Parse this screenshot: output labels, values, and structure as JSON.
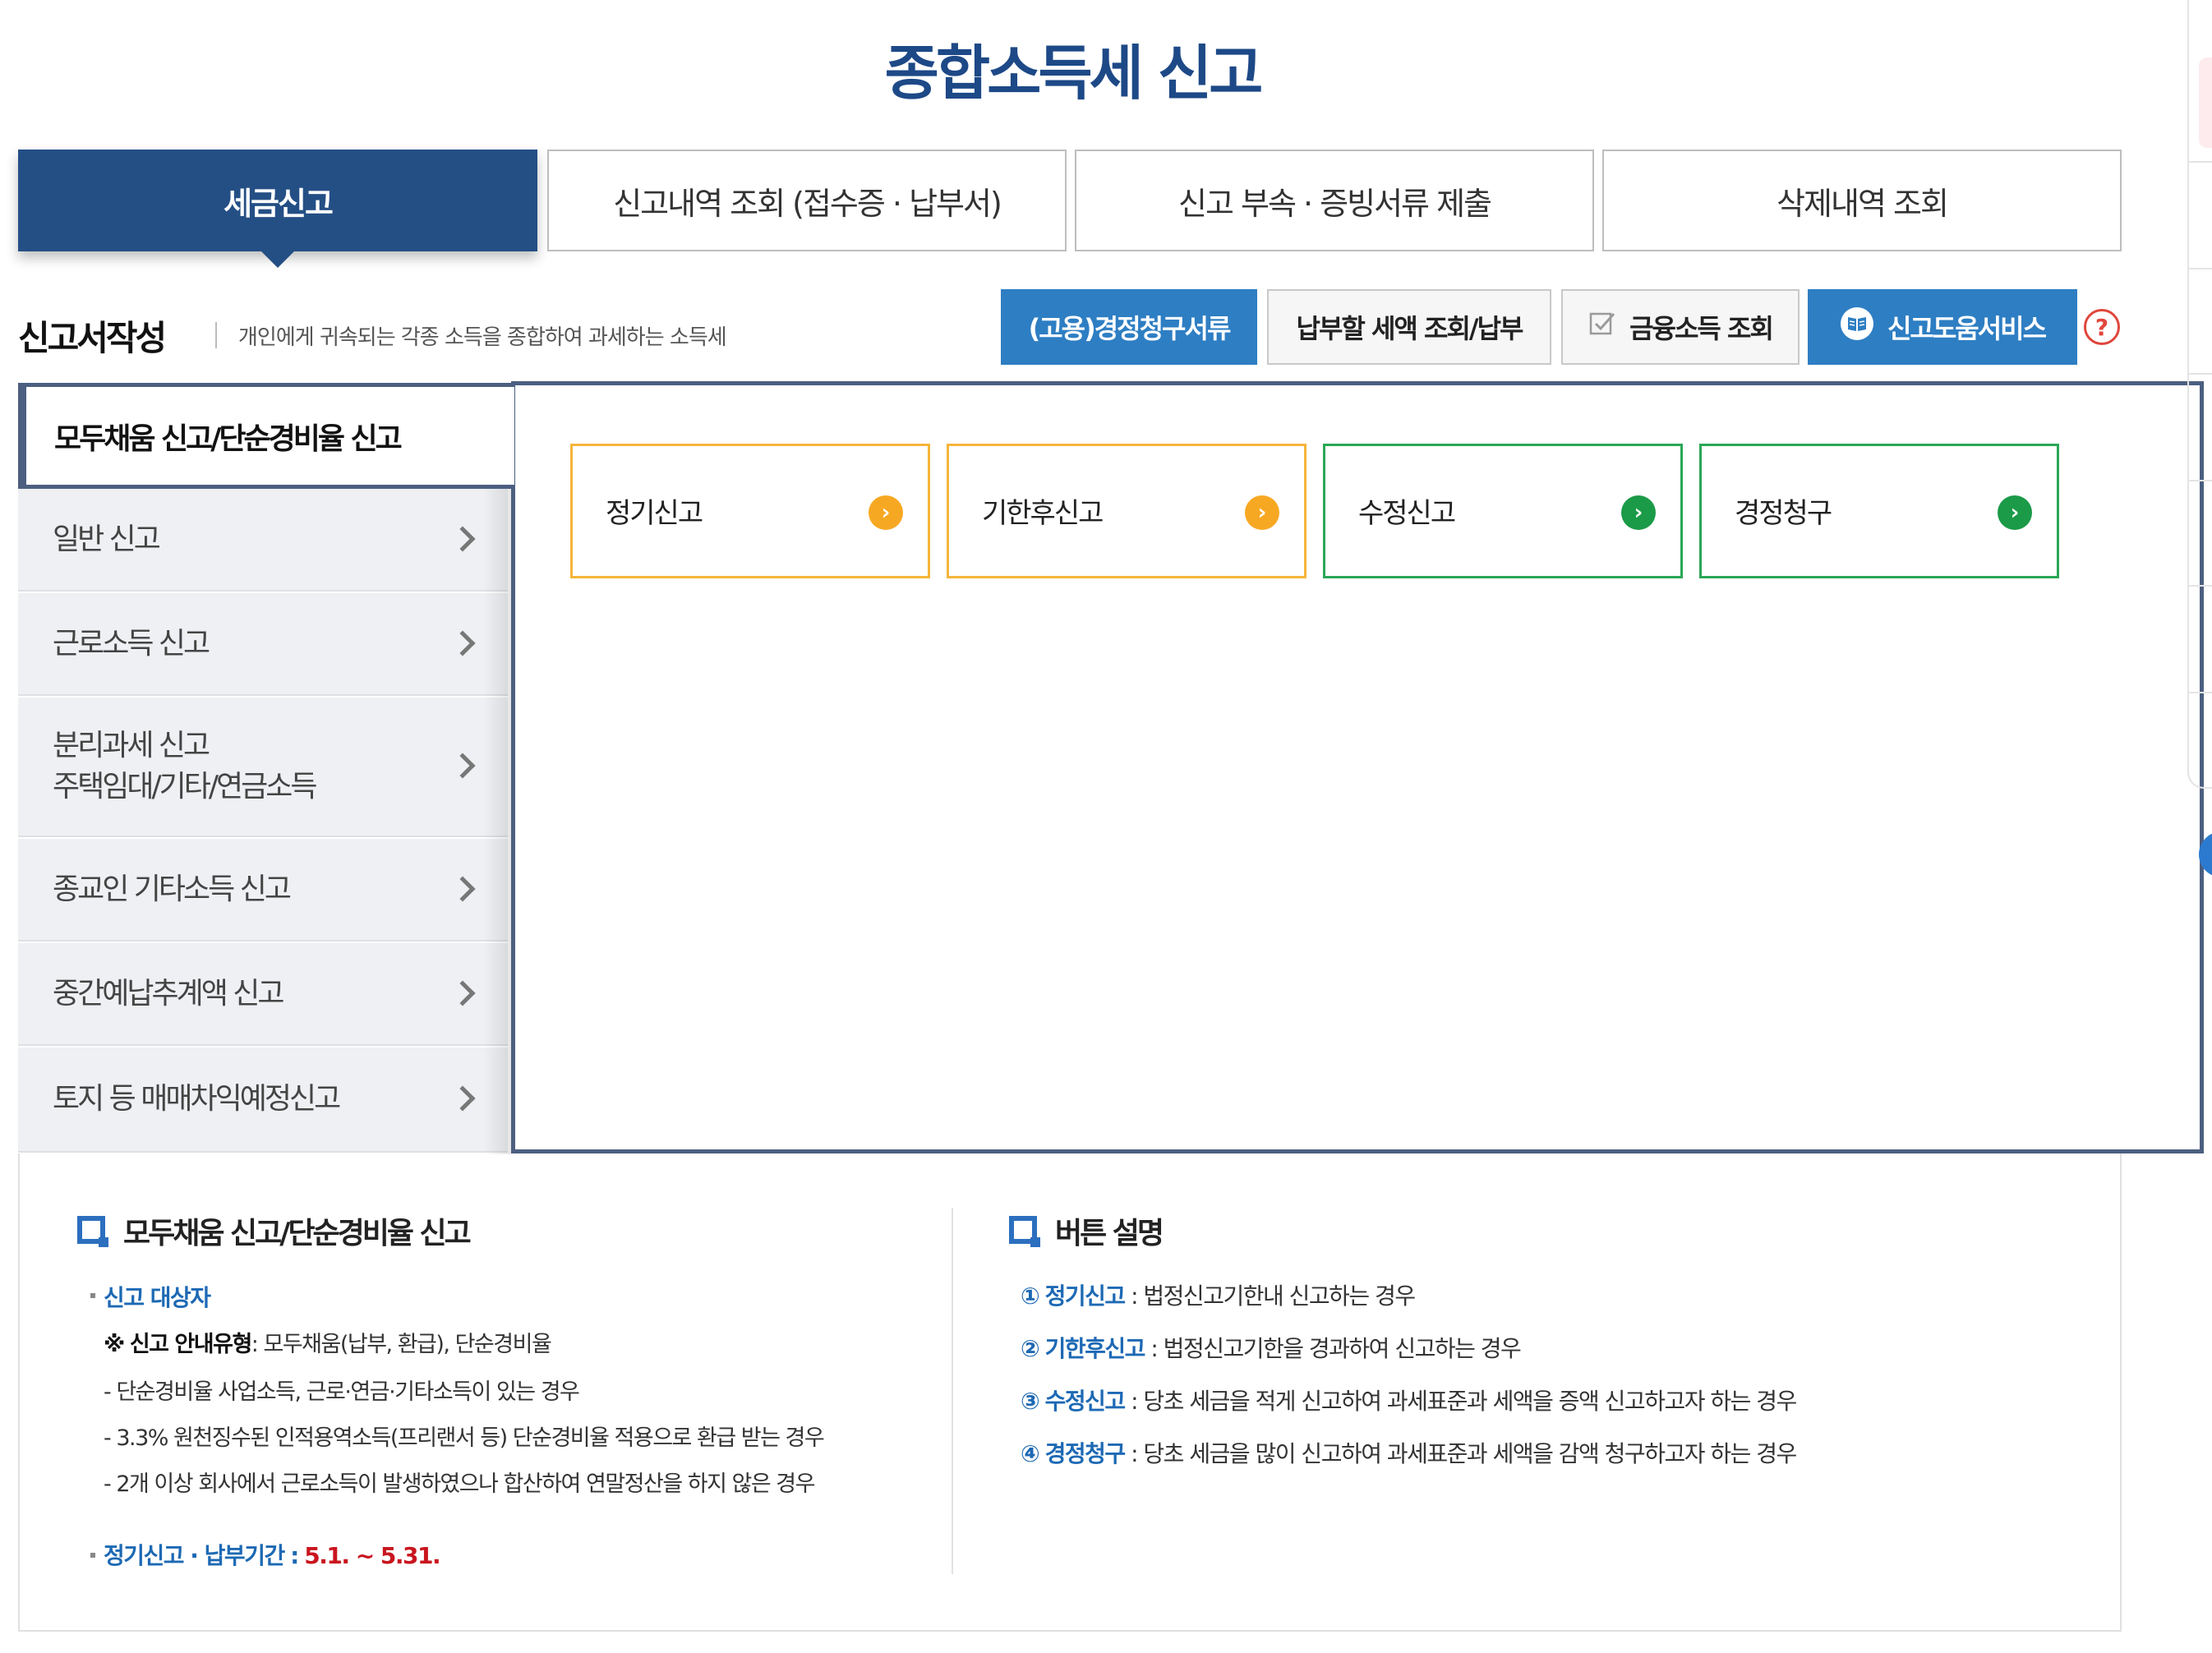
{
  "page_title": "종합소득세 신고",
  "tabs": [
    {
      "label": "세금신고",
      "active": true
    },
    {
      "label": "신고내역 조회 (접수증 · 납부서)",
      "active": false
    },
    {
      "label": "신고 부속 · 증빙서류 제출",
      "active": false
    },
    {
      "label": "삭제내역 조회",
      "active": false
    }
  ],
  "section": {
    "title": "신고서작성",
    "description": "개인에게 귀속되는 각종 소득을 종합하여 과세하는 소득세"
  },
  "action_buttons": {
    "employment_refund": "(고용)경정청구서류",
    "tax_payment": "납부할 세액 조회/납부",
    "financial_income": "금융소득 조회",
    "help_service": "신고도움서비스",
    "help_icon": "?"
  },
  "left_menu": {
    "selected": "모두채움 신고/단순경비율 신고",
    "items": [
      {
        "line1": "일반 신고",
        "line2": ""
      },
      {
        "line1": "근로소득 신고",
        "line2": ""
      },
      {
        "line1": "분리과세 신고",
        "line2": "주택임대/기타/연금소득"
      },
      {
        "line1": "종교인 기타소득 신고",
        "line2": ""
      },
      {
        "line1": "중간예납추계액 신고",
        "line2": ""
      },
      {
        "line1": "토지 등 매매차익예정신고",
        "line2": ""
      }
    ]
  },
  "options": [
    {
      "label": "정기신고",
      "color": "#f7a823"
    },
    {
      "label": "기한후신고",
      "color": "#f7a823"
    },
    {
      "label": "수정신고",
      "color": "#1b9a48"
    },
    {
      "label": "경정청구",
      "color": "#1b9a48"
    }
  ],
  "info_left": {
    "heading": "모두채움 신고/단순경비율 신고",
    "target_label": "신고 대상자",
    "guide_prefix": "※",
    "guide_label": "신고 안내유형",
    "guide_text": ": 모두채움(납부, 환급), 단순경비율",
    "cases": [
      "단순경비율 사업소득, 근로·연금·기타소득이 있는 경우",
      "3.3% 원천징수된 인적용역소득(프리랜서 등) 단순경비율 적용으로 환급 받는 경우",
      "2개 이상 회사에서 근로소득이 발생하였으나 합산하여 연말정산을 하지 않은 경우"
    ],
    "period_label": "정기신고 · 납부기간",
    "period_sep": ":",
    "period_value": "5.1. ~ 5.31."
  },
  "info_right": {
    "heading": "버튼 설명",
    "items": [
      {
        "num": "①",
        "term": "정기신고",
        "desc": ": 법정신고기한내 신고하는 경우"
      },
      {
        "num": "②",
        "term": "기한후신고",
        "desc": ": 법정신고기한을 경과하여 신고하는 경우"
      },
      {
        "num": "③",
        "term": "수정신고",
        "desc": ": 당초 세금을 적게 신고하여 과세표준과 세액을 증액 신고하고자 하는 경우"
      },
      {
        "num": "④",
        "term": "경정청구",
        "desc": ": 당초 세금을 많이 신고하여 과세표준과 세액을 감액 청구하고자 하는 경우"
      }
    ]
  },
  "colors": {
    "brand_navy": "#244f85",
    "button_blue": "#2e7ec3",
    "accent_blue": "#1d69b4",
    "period_red": "#c9151e"
  }
}
